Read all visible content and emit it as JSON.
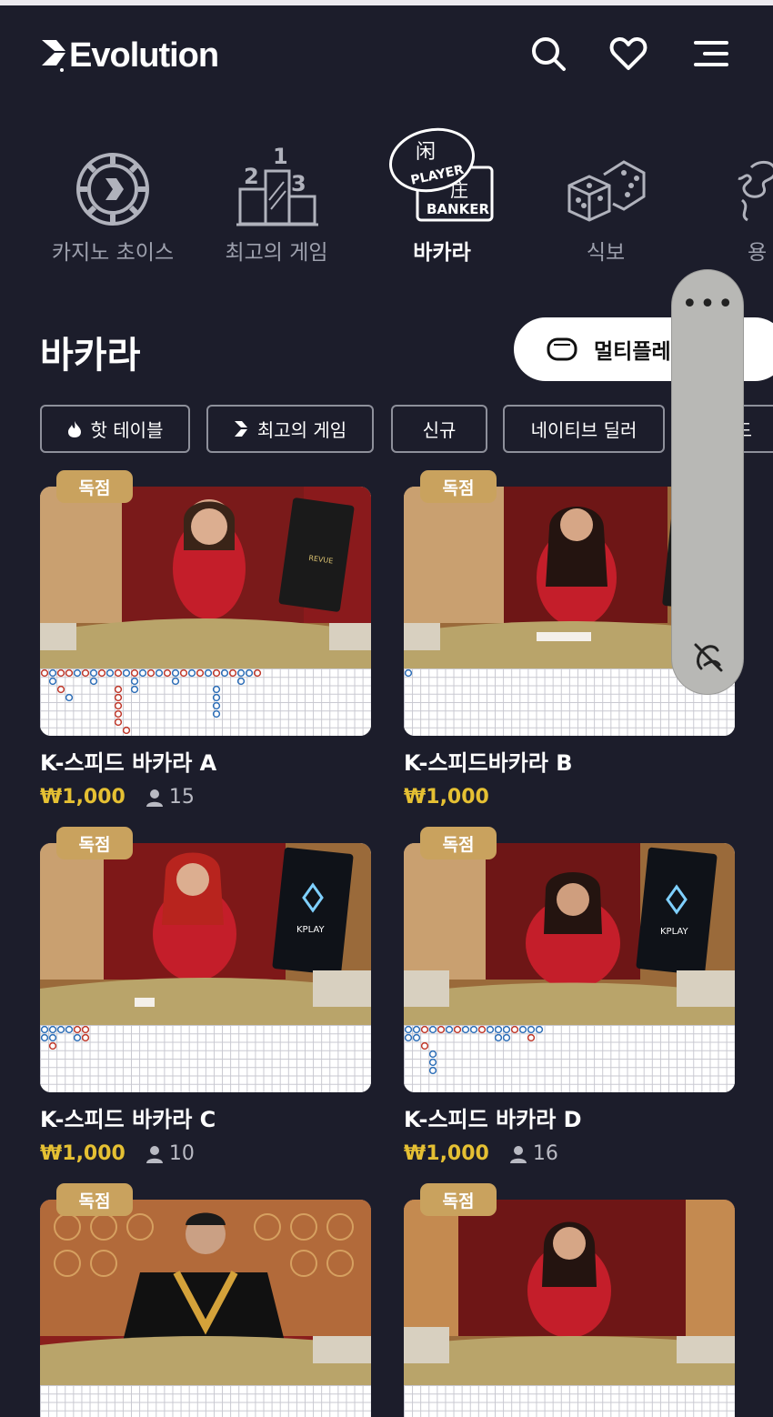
{
  "header": {
    "logo_text": "Evolution",
    "icons": [
      "search-icon",
      "heart-icon",
      "menu-icon"
    ]
  },
  "categories": [
    {
      "label": "카지노 초이스",
      "icon": "casino-chip-icon",
      "active": false
    },
    {
      "label": "최고의 게임",
      "icon": "podium-icon",
      "active": false
    },
    {
      "label": "바카라",
      "icon": "baccarat-icon",
      "active": true,
      "icon_text": {
        "player": "PLAYER",
        "banker": "BANKER"
      }
    },
    {
      "label": "식보",
      "icon": "dice-icon",
      "active": false
    },
    {
      "label": "용",
      "icon": "dragon-icon",
      "active": false
    }
  ],
  "section": {
    "title": "바카라",
    "multiplay_label": "멀티플레"
  },
  "filters": [
    {
      "label": "핫 테이블",
      "icon": "fire-icon"
    },
    {
      "label": "최고의 게임",
      "icon": "evolution-mark-icon"
    },
    {
      "label": "신규"
    },
    {
      "label": "네이티브 딜러"
    },
    {
      "label": "드"
    }
  ],
  "games": [
    {
      "badge": "독점",
      "name": "K-스피드 바카라 A",
      "price": "₩1,000",
      "players": "15",
      "screen_text": "REVUE"
    },
    {
      "badge": "독점",
      "name": "K-스피드바카라 B",
      "price": "₩1,000",
      "players": null
    },
    {
      "badge": "독점",
      "name": "K-스피드 바카라 C",
      "price": "₩1,000",
      "players": "10",
      "screen_text": "KPLAY"
    },
    {
      "badge": "독점",
      "name": "K-스피드 바카라 D",
      "price": "₩1,000",
      "players": "16",
      "screen_text": "KPLAY"
    },
    {
      "badge": "독점",
      "name": "",
      "price": "",
      "players": null
    },
    {
      "badge": "독점",
      "name": "",
      "price": "",
      "players": null
    }
  ],
  "overlay": {
    "dots": "•••",
    "icon": "hide-overlay-icon"
  },
  "colors": {
    "background": "#1c1d2b",
    "badge": "#c9a25e",
    "price": "#e5c033",
    "table_felt": "#b9a46a",
    "curtain_red": "#8a1a1c"
  }
}
